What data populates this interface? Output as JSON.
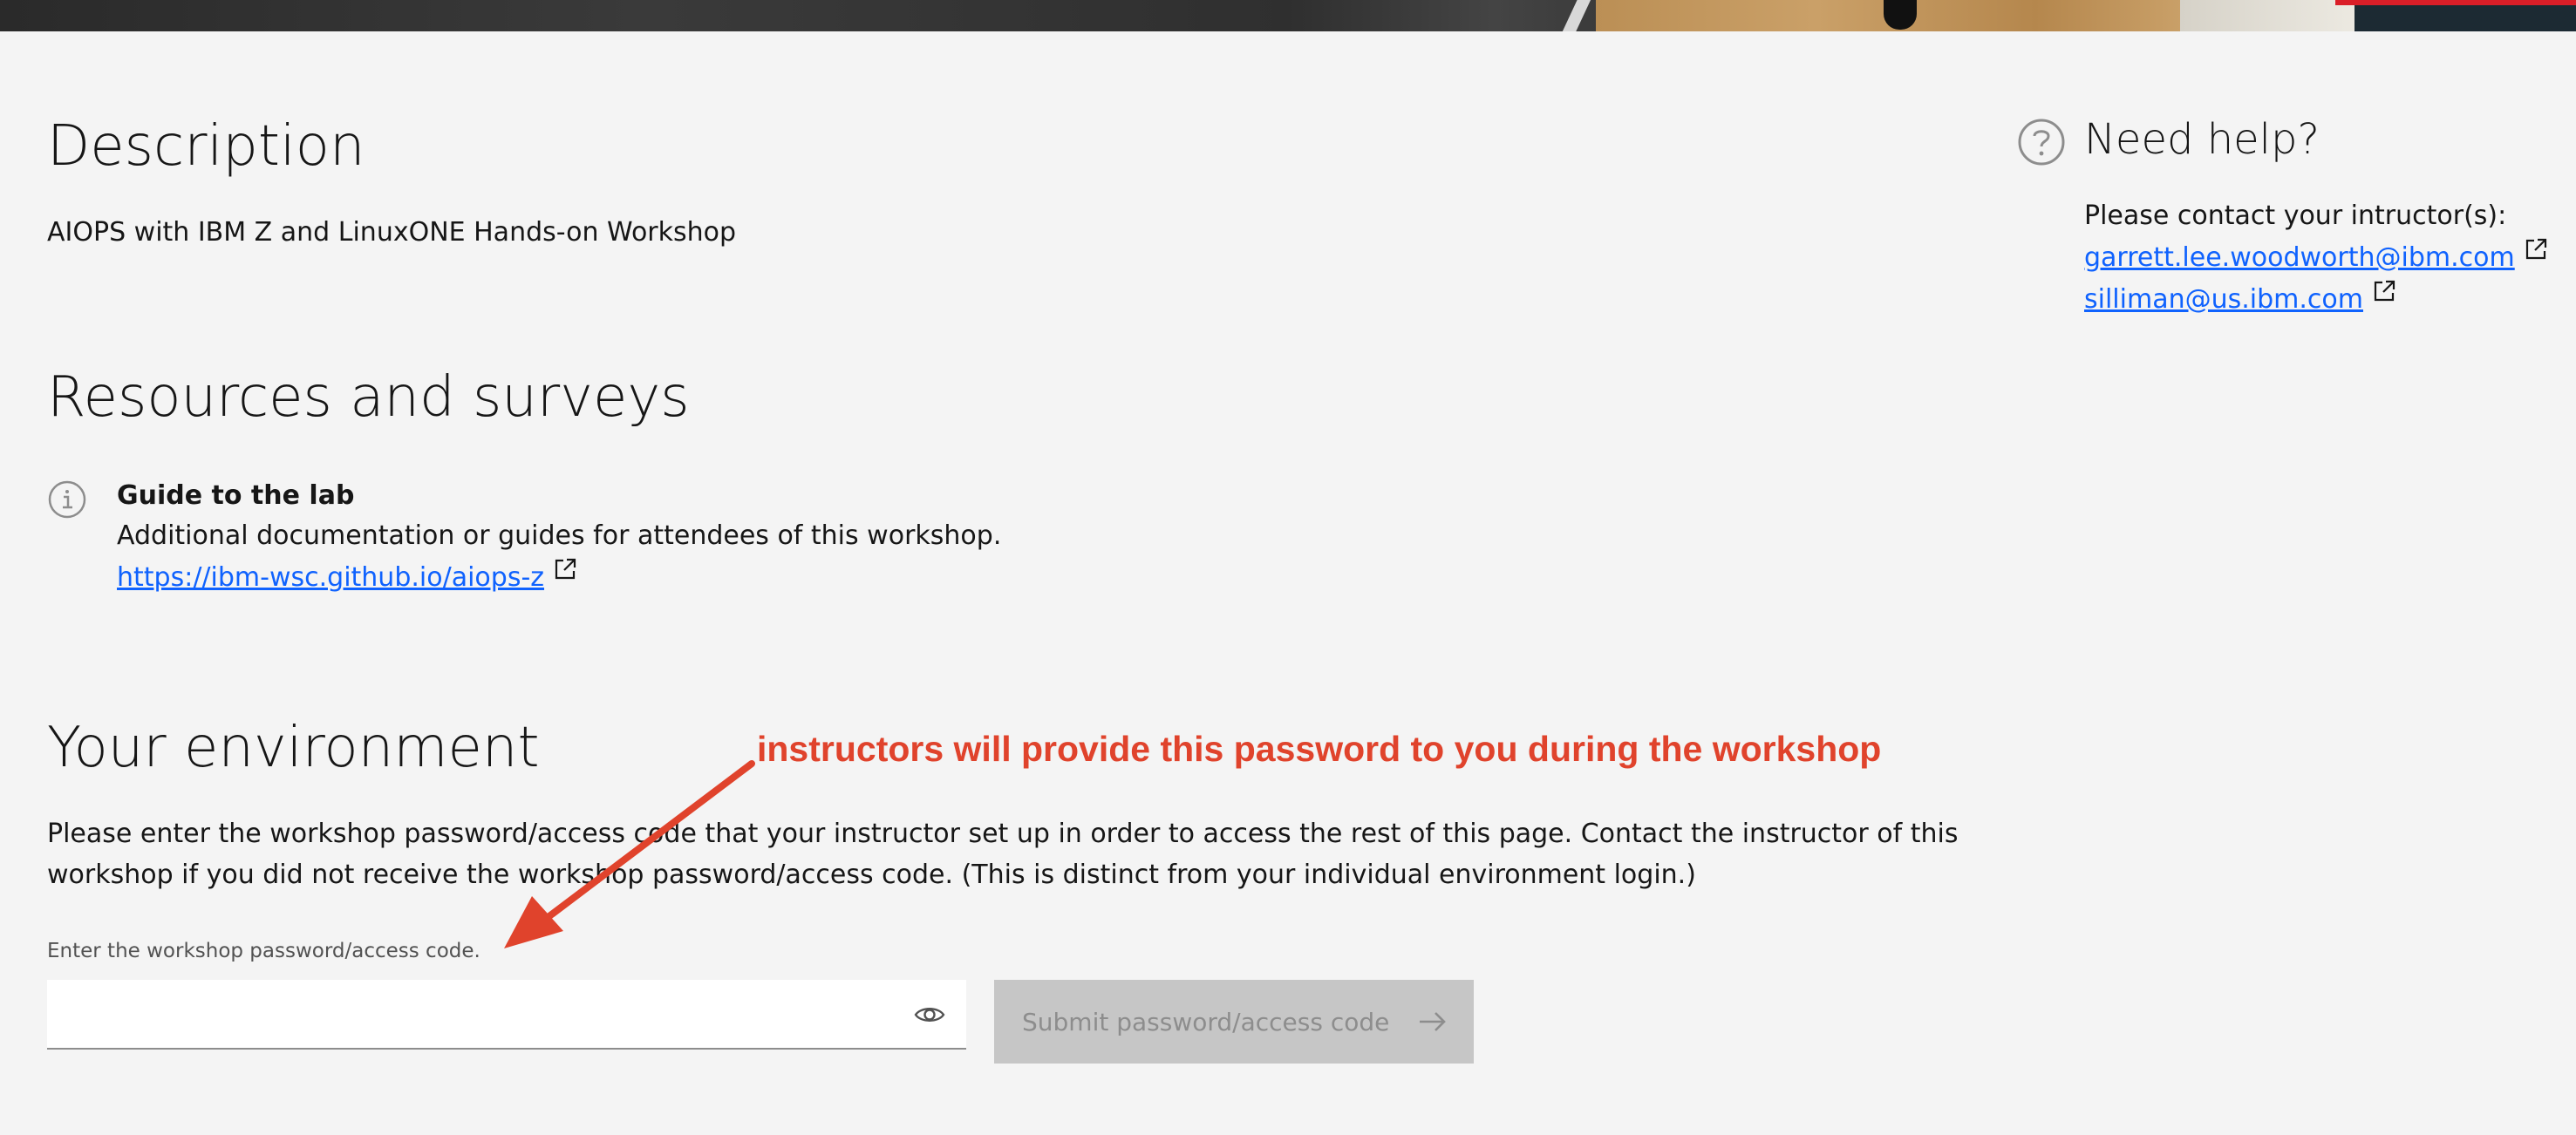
{
  "description": {
    "title": "Description",
    "text": "AIOPS with IBM Z and LinuxONE Hands-on Workshop"
  },
  "resources": {
    "title": "Resources and surveys",
    "items": [
      {
        "icon": "info-icon",
        "name": "Guide to the lab",
        "description": "Additional documentation or guides for attendees of this workshop.",
        "link": "https://ibm-wsc.github.io/aiops-z"
      }
    ]
  },
  "environment": {
    "title": "Your environment",
    "instructions": "Please enter the workshop password/access code that your instructor set up in order to access the rest of this page. Contact the instructor of this workshop if you did not receive the workshop password/access code. (This is distinct from your individual environment login.)",
    "password_label": "Enter the workshop password/access code.",
    "password_value": "",
    "submit_label": "Submit password/access code"
  },
  "annotation": {
    "text": "instructors will provide this password to you during the workshop",
    "color": "#e0432c"
  },
  "help": {
    "title": "Need help?",
    "contact_text": "Please contact your intructor(s):",
    "contacts": [
      "garrett.lee.woodworth@ibm.com",
      "silliman@us.ibm.com"
    ]
  },
  "colors": {
    "background": "#f4f4f4",
    "link": "#0f62fe",
    "disabled_button": "#c6c6c6",
    "accent_red": "#da1e28"
  }
}
